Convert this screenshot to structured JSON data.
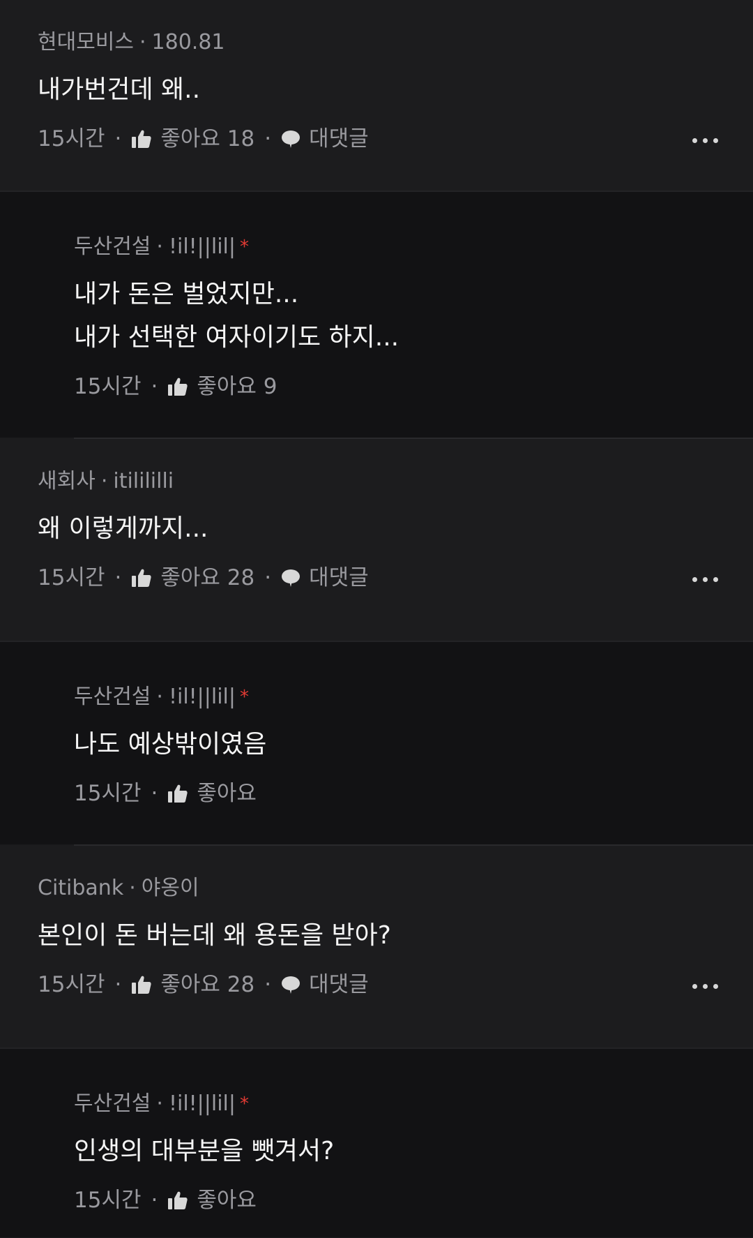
{
  "comments": [
    {
      "type": "top",
      "company": "현대모비스",
      "user": "180.81",
      "text": [
        "내가번건데 왜.."
      ],
      "time": "15시간",
      "likes_label": "좋아요 18",
      "reply_label": "대댓글"
    },
    {
      "type": "reply",
      "company": "두산건설",
      "user": "!il!||lil|",
      "badge": "*",
      "text": [
        "내가 돈은 벌었지만...",
        "내가 선택한 여자이기도 하지..."
      ],
      "time": "15시간",
      "likes_label": "좋아요 9"
    },
    {
      "type": "top",
      "company": "새회사",
      "user": "itilililli",
      "text": [
        "왜 이렇게까지..."
      ],
      "time": "15시간",
      "likes_label": "좋아요 28",
      "reply_label": "대댓글"
    },
    {
      "type": "reply",
      "company": "두산건설",
      "user": "!il!||lil|",
      "badge": "*",
      "text": [
        "나도 예상밖이였음"
      ],
      "time": "15시간",
      "likes_label": "좋아요"
    },
    {
      "type": "top",
      "company": "Citibank",
      "user": "야옹이",
      "text": [
        "본인이 돈 버는데 왜 용돈을 받아?"
      ],
      "time": "15시간",
      "likes_label": "좋아요 28",
      "reply_label": "대댓글"
    },
    {
      "type": "reply",
      "company": "두산건설",
      "user": "!il!||lil|",
      "badge": "*",
      "text": [
        "인생의 대부분을 뺏겨서?"
      ],
      "time": "15시간",
      "likes_label": "좋아요"
    }
  ],
  "separator": "·",
  "icons": {
    "like": "thumbs-up-icon",
    "reply": "speech-bubble-icon",
    "more": "more-dots-icon"
  },
  "colors": {
    "background": "#1c1c1e",
    "reply_background": "#121214",
    "muted_text": "#9a9a9f",
    "badge": "#e23b34"
  }
}
